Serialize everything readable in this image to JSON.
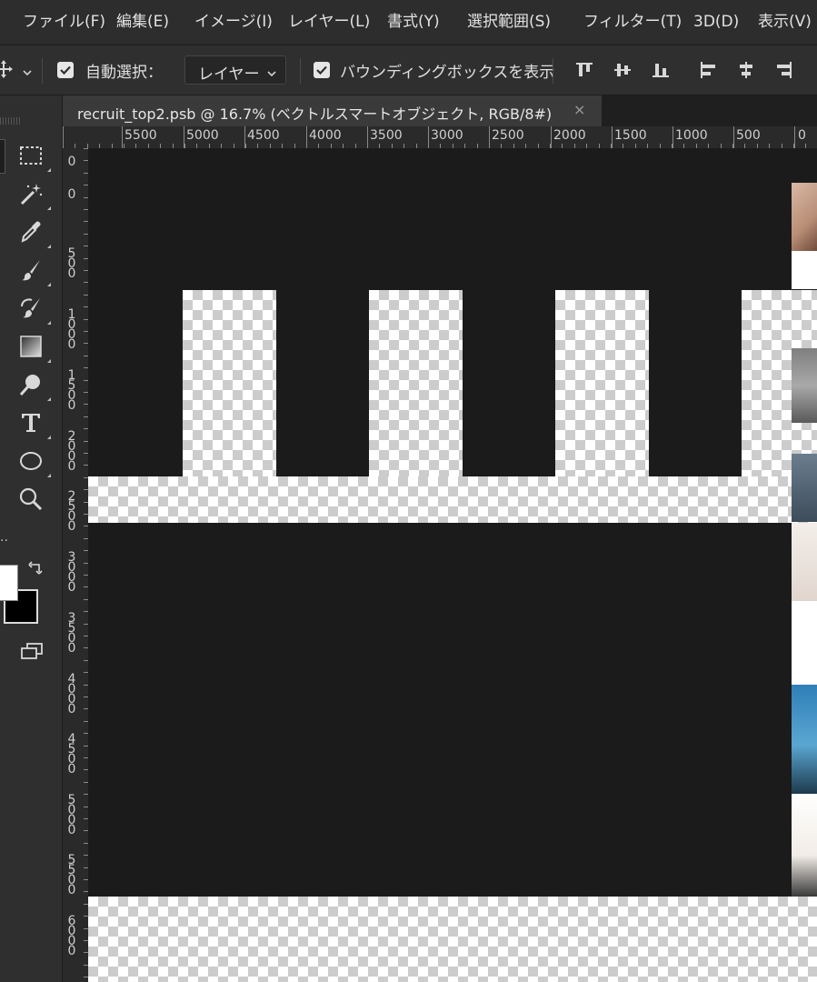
{
  "menu": {
    "items": [
      "ファイル(F)",
      "編集(E)",
      "イメージ(I)",
      "レイヤー(L)",
      "書式(Y)",
      "選択範囲(S)",
      "フィルター(T)",
      "3D(D)",
      "表示(V)"
    ]
  },
  "options_bar": {
    "auto_select_checked": true,
    "auto_select_label": "自動選択：",
    "auto_select_target": "レイヤー",
    "bounding_box_checked": true,
    "bounding_box_label": "バウンディングボックスを表示"
  },
  "document": {
    "tab_title": "recruit_top2.psb @ 16.7% (ベクトルスマートオブジェクト, RGB/8#)",
    "close_glyph": "×",
    "zoom_percent": 16.7,
    "color_mode": "RGB/8#"
  },
  "rulers": {
    "horizontal_labels": [
      "5500",
      "5000",
      "4500",
      "4000",
      "3500",
      "3000",
      "2500",
      "2000",
      "1500",
      "1000",
      "500",
      "0"
    ],
    "vertical_labels": [
      "0",
      "0",
      "500",
      "1000",
      "1500",
      "2000",
      "2500",
      "3000",
      "3500",
      "4000",
      "4500",
      "5000",
      "5500",
      "6000"
    ]
  },
  "colors": {
    "app_background": "#282828",
    "canvas_background": "#1b1b1b",
    "foreground_swatch": "#ffffff",
    "background_swatch": "#000000"
  },
  "tools": [
    "move",
    "marquee-rect",
    "magic-wand",
    "eyedropper",
    "brush",
    "history-brush",
    "gradient",
    "dodge",
    "type",
    "ellipse",
    "zoom",
    "edit-toolbar"
  ]
}
